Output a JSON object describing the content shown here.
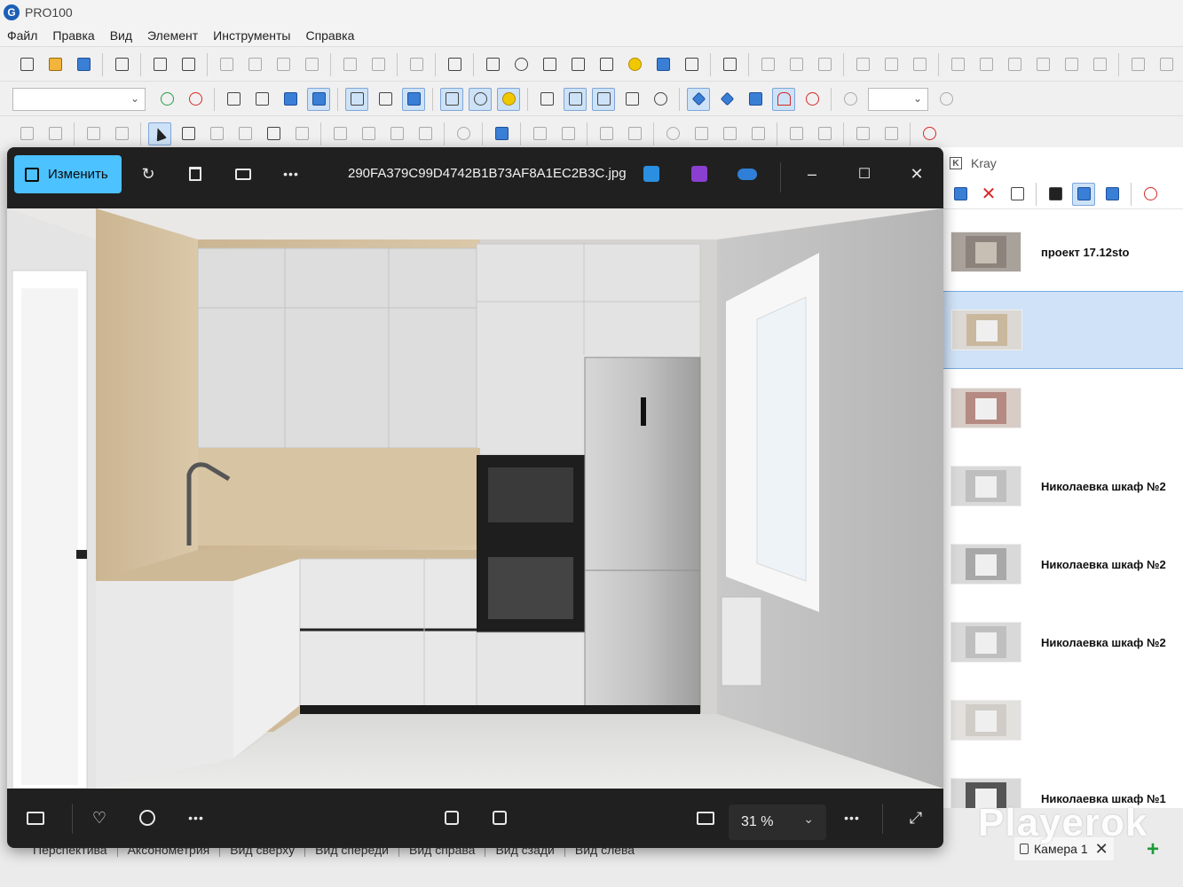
{
  "app": {
    "title": "PRO100",
    "logo_letter": "G"
  },
  "menu": [
    "Файл",
    "Правка",
    "Вид",
    "Элемент",
    "Инструменты",
    "Справка"
  ],
  "bottom_tabs": [
    "Перспектива",
    "Аксонометрия",
    "Вид сверху",
    "Вид спереди",
    "Вид справа",
    "Вид сзади",
    "Вид слева"
  ],
  "camera_tab": {
    "label": "Камера 1",
    "close": "✕"
  },
  "add_tab": "+",
  "watermark": "Playerok",
  "kray": {
    "title": "Kray",
    "logo": "K",
    "items": [
      {
        "label": "проект 17.12sto",
        "selected": false
      },
      {
        "label": "",
        "selected": true
      },
      {
        "label": "",
        "selected": false
      },
      {
        "label": "Николаевка шкаф №2",
        "selected": false
      },
      {
        "label": "Николаевка шкаф №2",
        "selected": false
      },
      {
        "label": "Николаевка шкаф №2",
        "selected": false
      },
      {
        "label": "",
        "selected": false
      },
      {
        "label": "Николаевка шкаф №1",
        "selected": false
      }
    ]
  },
  "viewer": {
    "edit_label": "Изменить",
    "filename": "290FA379C99D4742B1B73AF8A1EC2B3C.jpg",
    "zoom": "31 %",
    "more": "•••",
    "minimize": "–",
    "maximize": "☐",
    "close": "✕"
  },
  "colors": {
    "accent": "#4cc2ff",
    "viewer_bg": "#202020",
    "selection": "#cfe2f7"
  }
}
